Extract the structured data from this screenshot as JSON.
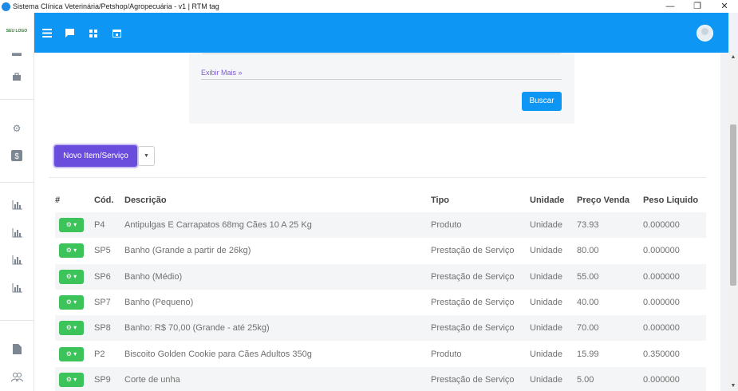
{
  "window": {
    "title": "Sistema Clínica Veterinária/Petshop/Agropecuária - v1 | RTM tag",
    "minimize": "—",
    "restore": "❐",
    "close": "✕"
  },
  "topbar": {
    "icons": [
      "menu-icon",
      "chat-icon",
      "grid-icon",
      "calendar-icon"
    ]
  },
  "sidebar": {
    "logo_text": "SEU LOGO",
    "icons": [
      "inbox-icon",
      "bag-icon",
      "gear-icon",
      "dollar-icon",
      "bar-chart-icon",
      "bar-chart-icon",
      "bar-chart-icon",
      "bar-chart-icon",
      "document-icon",
      "users-icon"
    ]
  },
  "filter": {
    "more_label": "Exibir Mais »",
    "search_button": "Buscar"
  },
  "actions": {
    "new_button": "Novo Item/Serviço",
    "caret": "▼"
  },
  "table": {
    "headers": [
      "#",
      "Cód.",
      "Descrição",
      "Tipo",
      "Unidade",
      "Preço Venda",
      "Peso Liquido"
    ],
    "rows": [
      {
        "code": "P4",
        "desc": "Antipulgas E Carrapatos 68mg Cães 10 A 25 Kg",
        "type": "Produto",
        "unit": "Unidade",
        "price": "73.93",
        "weight": "0.000000"
      },
      {
        "code": "SP5",
        "desc": "Banho (Grande a partir de 26kg)",
        "type": "Prestação de Serviço",
        "unit": "Unidade",
        "price": "80.00",
        "weight": "0.000000"
      },
      {
        "code": "SP6",
        "desc": "Banho (Médio)",
        "type": "Prestação de Serviço",
        "unit": "Unidade",
        "price": "55.00",
        "weight": "0.000000"
      },
      {
        "code": "SP7",
        "desc": "Banho (Pequeno)",
        "type": "Prestação de Serviço",
        "unit": "Unidade",
        "price": "40.00",
        "weight": "0.000000"
      },
      {
        "code": "SP8",
        "desc": "Banho: R$ 70,00 (Grande - até 25kg)",
        "type": "Prestação de Serviço",
        "unit": "Unidade",
        "price": "70.00",
        "weight": "0.000000"
      },
      {
        "code": "P2",
        "desc": "Biscoito Golden Cookie para Cães Adultos 350g",
        "type": "Produto",
        "unit": "Unidade",
        "price": "15.99",
        "weight": "0.350000"
      },
      {
        "code": "SP9",
        "desc": "Corte de unha",
        "type": "Prestação de Serviço",
        "unit": "Unidade",
        "price": "5.00",
        "weight": "0.000000"
      }
    ],
    "action_label": "⚙ ▾"
  },
  "colors": {
    "topbar": "#0e96f4",
    "new_button": "#6a4ddc",
    "action_button": "#3cc45a"
  }
}
